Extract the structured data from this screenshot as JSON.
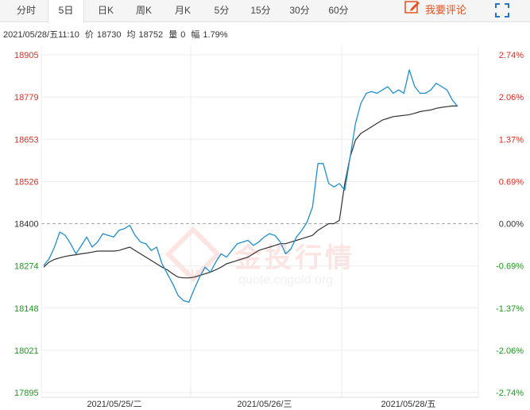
{
  "tabs": [
    {
      "label": "分时"
    },
    {
      "label": "5日"
    },
    {
      "label": "日K"
    },
    {
      "label": "周K"
    },
    {
      "label": "月K"
    },
    {
      "label": "5分"
    },
    {
      "label": "15分"
    },
    {
      "label": "30分"
    },
    {
      "label": "60分"
    }
  ],
  "active_tab": "5日",
  "comment_button": {
    "label": "我要评论"
  },
  "info": {
    "datetime": "2021/05/28/五11:10",
    "price_label": "价",
    "price": "18730",
    "avg_label": "均",
    "avg": "18752",
    "volume_label": "量",
    "volume": "0",
    "change_label": "幅",
    "change": "1.79%"
  },
  "watermark": {
    "text": "金投行情",
    "sub": "quote.cngold.org",
    "badge": "AU"
  },
  "colors": {
    "up": "#e8281e",
    "down": "#1a9a1a",
    "price_line": "#1f8fd0",
    "avg_line": "#333333",
    "accent": "#e8501e"
  },
  "chart_data": {
    "type": "line",
    "prev_close": 18400,
    "y_ticks": [
      "18905",
      "18779",
      "18653",
      "18526",
      "18400",
      "18274",
      "18148",
      "18021",
      "17895"
    ],
    "pct_ticks": [
      "2.74%",
      "2.06%",
      "1.37%",
      "0.69%",
      "0.00%",
      "-0.69%",
      "-1.37%",
      "-2.06%",
      "-2.74%"
    ],
    "ylim": [
      17895,
      18905
    ],
    "x_labels": [
      "2021/05/25/二",
      "2021/05/26/三",
      "2021/05/28/五"
    ],
    "grid": true,
    "series": [
      {
        "values": [
          18275,
          18295,
          18330,
          18375,
          18365,
          18340,
          18310,
          18335,
          18360,
          18330,
          18345,
          18370,
          18365,
          18360,
          18380,
          18385,
          18395,
          18365,
          18345,
          18340,
          18320,
          18330,
          18280,
          18250,
          18220,
          18185,
          18170,
          18165,
          18205,
          18240,
          18270,
          18255,
          18285,
          18310,
          18300,
          18320,
          18340,
          18345,
          18350,
          18335,
          18345,
          18360,
          18370,
          18365,
          18345,
          18310,
          18325,
          18360,
          18380,
          18405,
          18450,
          18580,
          18580,
          18520,
          18510,
          18520,
          18500,
          18600,
          18700,
          18760,
          18790,
          18795,
          18790,
          18800,
          18810,
          18790,
          18800,
          18790,
          18860,
          18810,
          18790,
          18790,
          18800,
          18820,
          18810,
          18800,
          18770,
          18750
        ]
      },
      {
        "values": [
          18270,
          18285,
          18293,
          18298,
          18302,
          18305,
          18307,
          18310,
          18312,
          18315,
          18318,
          18318,
          18318,
          18318,
          18320,
          18325,
          18330,
          18320,
          18310,
          18300,
          18290,
          18280,
          18270,
          18262,
          18250,
          18240,
          18238,
          18238,
          18240,
          18245,
          18250,
          18255,
          18262,
          18270,
          18280,
          18285,
          18290,
          18295,
          18300,
          18310,
          18320,
          18325,
          18330,
          18335,
          18340,
          18340,
          18345,
          18350,
          18355,
          18360,
          18365,
          18380,
          18390,
          18400,
          18400,
          18410,
          18520,
          18600,
          18650,
          18670,
          18680,
          18690,
          18700,
          18710,
          18715,
          18720,
          18722,
          18724,
          18726,
          18730,
          18735,
          18738,
          18740,
          18745,
          18748,
          18750,
          18752,
          18752
        ]
      }
    ]
  }
}
